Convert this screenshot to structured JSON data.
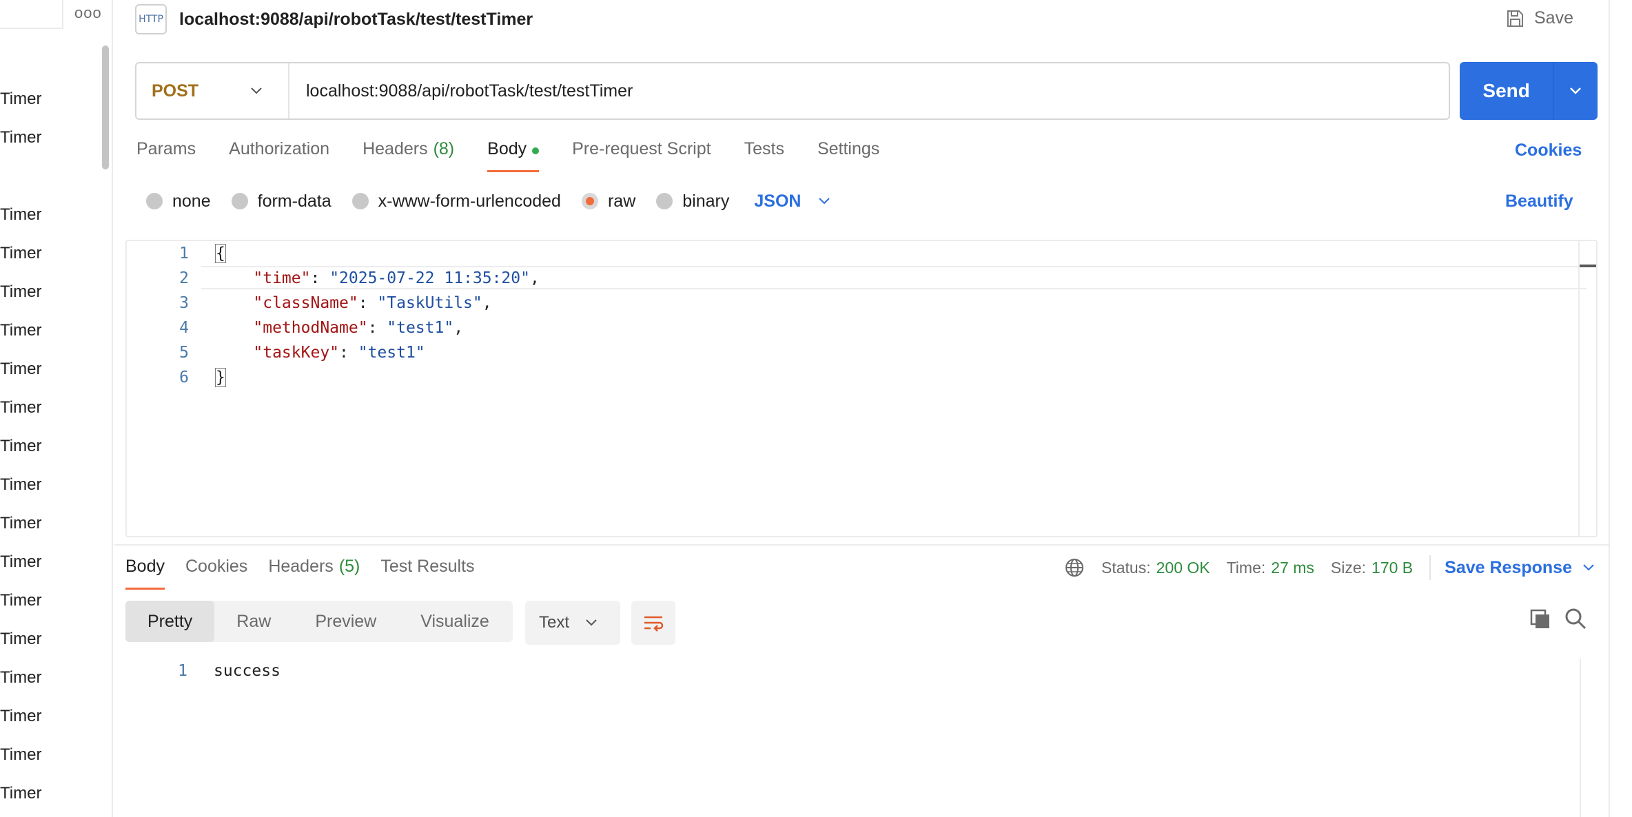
{
  "sidebar": {
    "more_label": "ooo",
    "items": [
      "Timer",
      "Timer",
      "Timer",
      "Timer",
      "Timer",
      "Timer",
      "Timer",
      "Timer",
      "Timer",
      "Timer",
      "Timer",
      "Timer",
      "Timer",
      "Timer",
      "Timer",
      "Timer",
      "Timer",
      "Timer"
    ]
  },
  "header": {
    "icon_text": "HTTP",
    "title": "localhost:9088/api/robotTask/test/testTimer",
    "save_label": "Save"
  },
  "request": {
    "method": "POST",
    "url": "localhost:9088/api/robotTask/test/testTimer",
    "send_label": "Send"
  },
  "tabs": {
    "params": "Params",
    "authorization": "Authorization",
    "headers": "Headers",
    "headers_count": "(8)",
    "body": "Body",
    "prerequest": "Pre-request Script",
    "tests": "Tests",
    "settings": "Settings",
    "cookies": "Cookies"
  },
  "body_types": {
    "none": "none",
    "form_data": "form-data",
    "urlencoded": "x-www-form-urlencoded",
    "raw": "raw",
    "binary": "binary",
    "format": "JSON",
    "beautify": "Beautify"
  },
  "editor": {
    "line_numbers": [
      "1",
      "2",
      "3",
      "4",
      "5",
      "6"
    ],
    "open_brace": "{",
    "close_brace": "}",
    "entries": [
      {
        "key": "\"time\"",
        "value": "\"2025-07-22 11:35:20\"",
        "sep": ","
      },
      {
        "key": "\"className\"",
        "value": "\"TaskUtils\"",
        "sep": ","
      },
      {
        "key": "\"methodName\"",
        "value": "\"test1\"",
        "sep": ","
      },
      {
        "key": "\"taskKey\"",
        "value": "\"test1\"",
        "sep": ""
      }
    ]
  },
  "response": {
    "tabs": {
      "body": "Body",
      "cookies": "Cookies",
      "headers": "Headers",
      "headers_count": "(5)",
      "test_results": "Test Results"
    },
    "status_label": "Status:",
    "status_value": "200 OK",
    "time_label": "Time:",
    "time_value": "27 ms",
    "size_label": "Size:",
    "size_value": "170 B",
    "save_response": "Save Response",
    "views": {
      "pretty": "Pretty",
      "raw": "Raw",
      "preview": "Preview",
      "visualize": "Visualize"
    },
    "format": "Text",
    "line_number": "1",
    "body_text": "success"
  },
  "colors": {
    "accent": "#2b6fe0",
    "method": "#a0701c",
    "success": "#2e8b3d",
    "active_tab": "#f26b3a"
  }
}
